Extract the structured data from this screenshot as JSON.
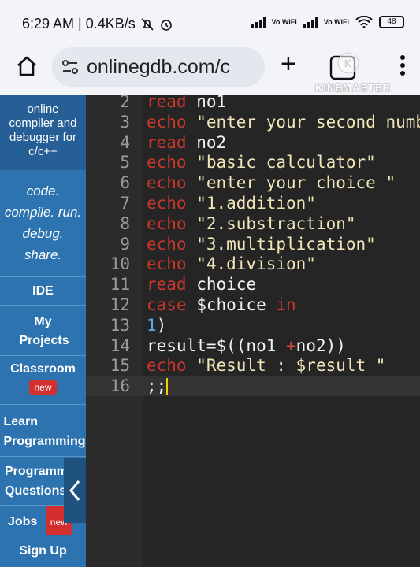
{
  "status": {
    "time_info": "6:29 AM | 0.4KB/s",
    "signal1": "Vo WiFi",
    "signal2": "Vo WiFi",
    "battery": "48"
  },
  "browser": {
    "url": "onlinegdb.com/c",
    "overlay_text": "KINEMASTER"
  },
  "sidebar": {
    "title_lines": [
      "online",
      "compiler and",
      "debugger for",
      "c/c++"
    ],
    "tagline_lines": [
      "code.",
      "compile. run.",
      "debug.",
      "share."
    ],
    "items": [
      {
        "label": "IDE"
      },
      {
        "label": "My Projects"
      },
      {
        "label": "Classroom",
        "badge": "new"
      },
      {
        "label": "Learn Programming"
      },
      {
        "label": "Programming Questions"
      },
      {
        "label": "Jobs",
        "badge": "new"
      },
      {
        "label": "Sign Up"
      }
    ]
  },
  "editor": {
    "lines": [
      {
        "num": "2",
        "parts": [
          [
            "kw",
            "read"
          ],
          [
            "txt",
            " no1"
          ]
        ]
      },
      {
        "num": "3",
        "parts": [
          [
            "kw",
            "echo"
          ],
          [
            "str",
            " \"enter your second number\""
          ]
        ]
      },
      {
        "num": "4",
        "parts": [
          [
            "kw",
            "read"
          ],
          [
            "txt",
            " no2"
          ]
        ]
      },
      {
        "num": "5",
        "parts": [
          [
            "kw",
            "echo"
          ],
          [
            "str",
            " \"basic calculator\""
          ]
        ]
      },
      {
        "num": "6",
        "parts": [
          [
            "kw",
            "echo"
          ],
          [
            "str",
            " \"enter your choice \""
          ]
        ]
      },
      {
        "num": "7",
        "parts": [
          [
            "kw",
            "echo"
          ],
          [
            "str",
            " \"1.addition\""
          ]
        ]
      },
      {
        "num": "8",
        "parts": [
          [
            "kw",
            "echo"
          ],
          [
            "str",
            " \"2.substraction\""
          ]
        ]
      },
      {
        "num": "9",
        "parts": [
          [
            "kw",
            "echo"
          ],
          [
            "str",
            " \"3.multiplication\""
          ]
        ]
      },
      {
        "num": "10",
        "parts": [
          [
            "kw",
            "echo"
          ],
          [
            "str",
            " \"4.division\""
          ]
        ]
      },
      {
        "num": "11",
        "parts": [
          [
            "kw",
            "read"
          ],
          [
            "txt",
            " choice"
          ]
        ]
      },
      {
        "num": "12",
        "parts": [
          [
            "kw",
            "case"
          ],
          [
            "txt",
            " $choice "
          ],
          [
            "kw",
            "in"
          ]
        ]
      },
      {
        "num": "13",
        "parts": [
          [
            "num",
            "1"
          ],
          [
            "txt",
            ")"
          ]
        ]
      },
      {
        "num": "14",
        "parts": [
          [
            "txt",
            "result=$((no1 "
          ],
          [
            "op",
            "+"
          ],
          [
            "txt",
            "no2))"
          ]
        ]
      },
      {
        "num": "15",
        "parts": [
          [
            "kw",
            "echo"
          ],
          [
            "str",
            " \"Result : $result \""
          ]
        ]
      },
      {
        "num": "16",
        "parts": [
          [
            "txt",
            ";;"
          ]
        ]
      }
    ]
  }
}
